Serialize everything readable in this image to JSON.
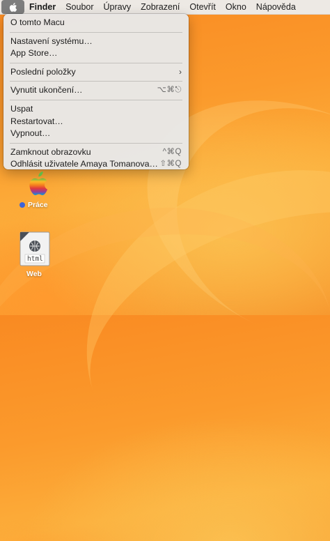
{
  "menubar": {
    "apple_icon": "apple-logo-icon",
    "items": [
      "Finder",
      "Soubor",
      "Úpravy",
      "Zobrazení",
      "Otevřít",
      "Okno",
      "Nápověda"
    ]
  },
  "apple_menu": {
    "about": "O tomto Macu",
    "system_settings": "Nastavení systému…",
    "app_store": "App Store…",
    "recent_items": "Poslední položky",
    "force_quit": "Vynutit ukončení…",
    "force_quit_shortcut": "⌥⌘⎋",
    "sleep": "Uspat",
    "restart": "Restartovat…",
    "shut_down": "Vypnout…",
    "lock_screen": "Zamknout obrazovku",
    "lock_screen_shortcut": "^⌘Q",
    "log_out": "Odhlásit uživatele Amaya Tomanova…",
    "log_out_shortcut": "⇧⌘Q"
  },
  "desktop": {
    "folder_label": "Práce",
    "folder_tag_color": "#3d64d8",
    "file_label": "Web",
    "file_badge": "html"
  }
}
